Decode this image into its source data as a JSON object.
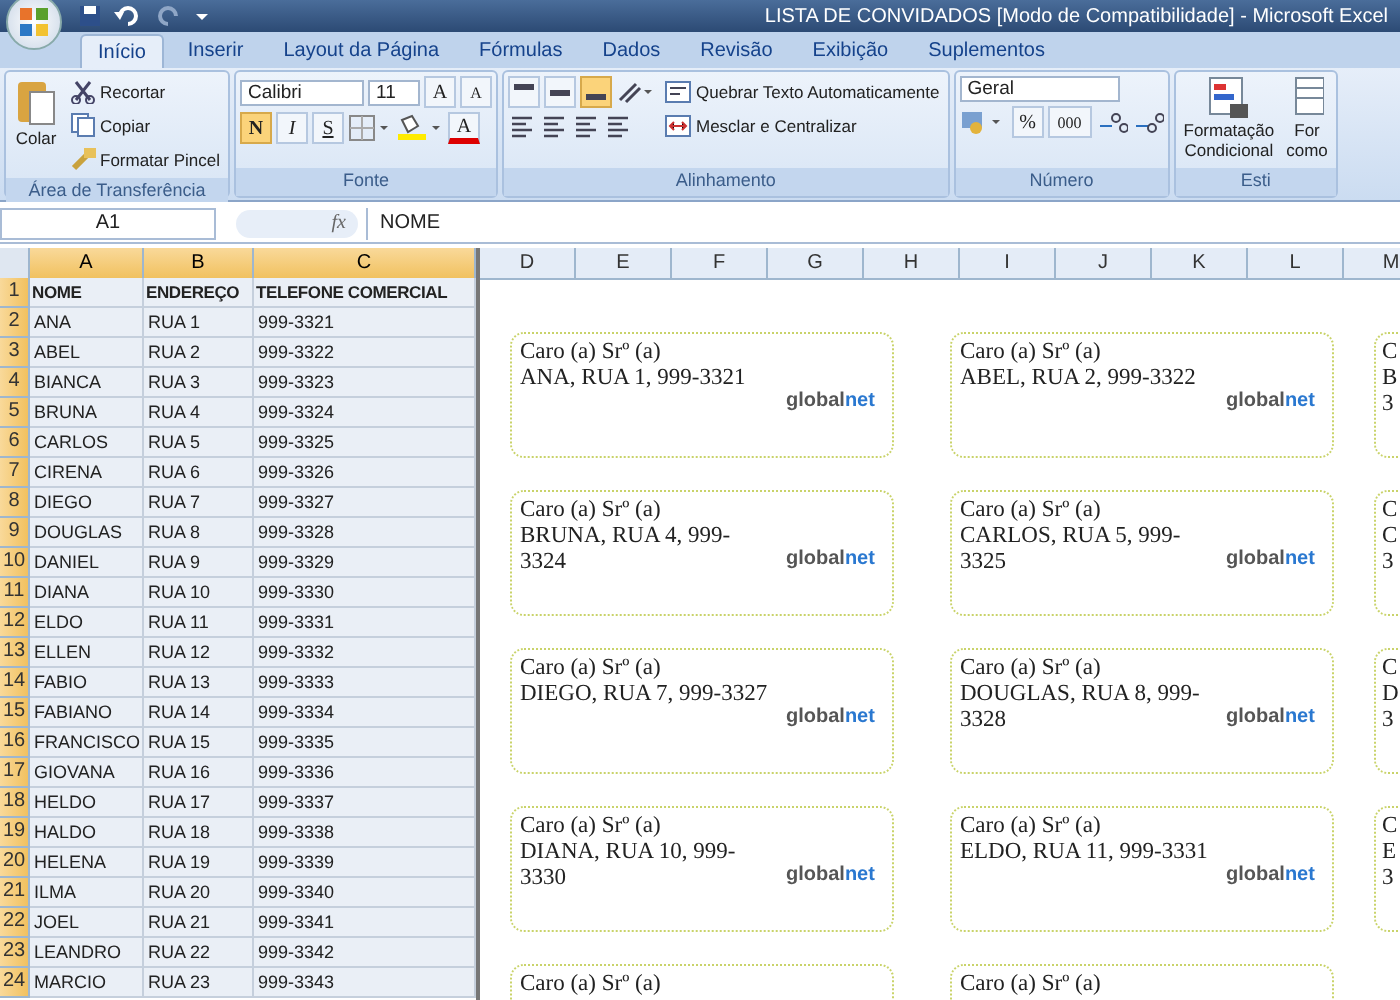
{
  "window": {
    "title": "LISTA DE CONVIDADOS  [Modo de Compatibilidade] - Microsoft Excel"
  },
  "tabs": [
    {
      "label": "Início",
      "selected": true
    },
    {
      "label": "Inserir",
      "selected": false
    },
    {
      "label": "Layout da Página",
      "selected": false
    },
    {
      "label": "Fórmulas",
      "selected": false
    },
    {
      "label": "Dados",
      "selected": false
    },
    {
      "label": "Revisão",
      "selected": false
    },
    {
      "label": "Exibição",
      "selected": false
    },
    {
      "label": "Suplementos",
      "selected": false
    }
  ],
  "ribbon": [
    {
      "kind": "clipboard",
      "label": "Área de Transferência",
      "paste": "Colar",
      "actions": [
        "Recortar",
        "Copiar",
        "Formatar Pincel"
      ]
    },
    {
      "kind": "font",
      "label": "Fonte",
      "font_name": "Calibri",
      "font_size": "11",
      "grow": "A",
      "shrink": "A",
      "font_color": "A",
      "styles": [
        {
          "label": "N",
          "on": true
        },
        {
          "label": "I",
          "on": false
        },
        {
          "label": "S",
          "on": false
        }
      ]
    },
    {
      "kind": "alignment",
      "label": "Alinhamento",
      "vertical": [
        {
          "selected": false
        },
        {
          "selected": false
        },
        {
          "selected": true
        }
      ],
      "wrap_text": "Quebrar Texto Automaticamente",
      "merge": "Mesclar e Centralizar"
    },
    {
      "kind": "number",
      "label": "Número",
      "format": "Geral",
      "percent": "%",
      "thousands": "000"
    },
    {
      "kind": "styles",
      "label": "Esti",
      "conditional": [
        "Formatação",
        "Condicional"
      ],
      "table": [
        "For",
        "como"
      ]
    }
  ],
  "formula_bar": {
    "name_box": "A1",
    "function_label": "fx",
    "content": "NOME"
  },
  "sheet": {
    "columns": [
      {
        "label": "A",
        "selected": true
      },
      {
        "label": "B",
        "selected": true
      },
      {
        "label": "C",
        "selected": true
      },
      {
        "label": "D",
        "selected": false
      },
      {
        "label": "E",
        "selected": false
      },
      {
        "label": "F",
        "selected": false
      },
      {
        "label": "G",
        "selected": false
      },
      {
        "label": "H",
        "selected": false
      },
      {
        "label": "I",
        "selected": false
      },
      {
        "label": "J",
        "selected": false
      },
      {
        "label": "K",
        "selected": false
      },
      {
        "label": "L",
        "selected": false
      },
      {
        "label": "M",
        "selected": false
      }
    ],
    "rows": [
      {
        "number": "1",
        "selected": true,
        "cells": [
          "NOME",
          "ENDEREÇO",
          "TELEFONE COMERCIAL"
        ]
      },
      {
        "number": "2",
        "selected": true,
        "cells": [
          "ANA",
          "RUA 1",
          "999-3321"
        ]
      },
      {
        "number": "3",
        "selected": true,
        "cells": [
          "ABEL",
          "RUA 2",
          "999-3322"
        ]
      },
      {
        "number": "4",
        "selected": true,
        "cells": [
          "BIANCA",
          "RUA 3",
          "999-3323"
        ]
      },
      {
        "number": "5",
        "selected": true,
        "cells": [
          "BRUNA",
          "RUA 4",
          "999-3324"
        ]
      },
      {
        "number": "6",
        "selected": true,
        "cells": [
          "CARLOS",
          "RUA 5",
          "999-3325"
        ]
      },
      {
        "number": "7",
        "selected": true,
        "cells": [
          "CIRENA",
          "RUA 6",
          "999-3326"
        ]
      },
      {
        "number": "8",
        "selected": true,
        "cells": [
          "DIEGO",
          "RUA 7",
          "999-3327"
        ]
      },
      {
        "number": "9",
        "selected": true,
        "cells": [
          "DOUGLAS",
          "RUA 8",
          "999-3328"
        ]
      },
      {
        "number": "10",
        "selected": true,
        "cells": [
          "DANIEL",
          "RUA 9",
          "999-3329"
        ]
      },
      {
        "number": "11",
        "selected": true,
        "cells": [
          "DIANA",
          "RUA 10",
          "999-3330"
        ]
      },
      {
        "number": "12",
        "selected": true,
        "cells": [
          "ELDO",
          "RUA 11",
          "999-3331"
        ]
      },
      {
        "number": "13",
        "selected": true,
        "cells": [
          "ELLEN",
          "RUA 12",
          "999-3332"
        ]
      },
      {
        "number": "14",
        "selected": true,
        "cells": [
          "FABIO",
          "RUA 13",
          "999-3333"
        ]
      },
      {
        "number": "15",
        "selected": true,
        "cells": [
          "FABIANO",
          "RUA 14",
          "999-3334"
        ]
      },
      {
        "number": "16",
        "selected": true,
        "cells": [
          "FRANCISCO",
          "RUA 15",
          "999-3335"
        ]
      },
      {
        "number": "17",
        "selected": true,
        "cells": [
          "GIOVANA",
          "RUA 16",
          "999-3336"
        ]
      },
      {
        "number": "18",
        "selected": true,
        "cells": [
          "HELDO",
          "RUA 17",
          "999-3337"
        ]
      },
      {
        "number": "19",
        "selected": true,
        "cells": [
          "HALDO",
          "RUA 18",
          "999-3338"
        ]
      },
      {
        "number": "20",
        "selected": true,
        "cells": [
          "HELENA",
          "RUA 19",
          "999-3339"
        ]
      },
      {
        "number": "21",
        "selected": true,
        "cells": [
          "ILMA",
          "RUA 20",
          "999-3340"
        ]
      },
      {
        "number": "22",
        "selected": true,
        "cells": [
          "JOEL",
          "RUA 21",
          "999-3341"
        ]
      },
      {
        "number": "23",
        "selected": true,
        "cells": [
          "LEANDRO",
          "RUA 22",
          "999-3342"
        ]
      },
      {
        "number": "24",
        "selected": true,
        "cells": [
          "MARCIO",
          "RUA 23",
          "999-3343"
        ]
      }
    ]
  },
  "labels": [
    {
      "cards": [
        {
          "kind": "full",
          "lines": [
            "Caro (a) Srº (a)",
            "ANA, RUA 1, 999-3321"
          ],
          "logo": [
            "global",
            "net"
          ]
        },
        {
          "kind": "full",
          "lines": [
            "Caro (a) Srº (a)",
            "ABEL, RUA 2, 999-3322"
          ],
          "logo": [
            "global",
            "net"
          ]
        },
        {
          "kind": "partial",
          "lines": [
            "C",
            "B",
            "3"
          ]
        }
      ]
    },
    {
      "cards": [
        {
          "kind": "full",
          "lines": [
            "Caro (a) Srº (a)",
            "BRUNA, RUA 4, 999-3324"
          ],
          "logo": [
            "global",
            "net"
          ]
        },
        {
          "kind": "full",
          "lines": [
            "Caro (a) Srº (a)",
            "CARLOS, RUA 5, 999-3325"
          ],
          "logo": [
            "global",
            "net"
          ]
        },
        {
          "kind": "partial",
          "lines": [
            "C",
            "C",
            "3"
          ]
        }
      ]
    },
    {
      "cards": [
        {
          "kind": "full",
          "lines": [
            "Caro (a) Srº (a)",
            "DIEGO, RUA 7, 999-3327"
          ],
          "logo": [
            "global",
            "net"
          ]
        },
        {
          "kind": "full",
          "lines": [
            "Caro (a) Srº (a)",
            "DOUGLAS, RUA 8, 999-3328"
          ],
          "logo": [
            "global",
            "net"
          ]
        },
        {
          "kind": "partial",
          "lines": [
            "C",
            "D",
            "3"
          ]
        }
      ]
    },
    {
      "cards": [
        {
          "kind": "full",
          "lines": [
            "Caro (a) Srº (a)",
            "DIANA, RUA 10, 999-3330"
          ],
          "logo": [
            "global",
            "net"
          ]
        },
        {
          "kind": "full",
          "lines": [
            "Caro (a) Srº (a)",
            "ELDO, RUA 11, 999-3331"
          ],
          "logo": [
            "global",
            "net"
          ]
        },
        {
          "kind": "partial",
          "lines": [
            "C",
            "E",
            "3"
          ]
        }
      ]
    },
    {
      "cards": [
        {
          "kind": "full",
          "lines": [
            "Caro (a) Srº (a)"
          ]
        },
        {
          "kind": "full",
          "lines": [
            "Caro (a) Srº (a)"
          ]
        }
      ]
    }
  ]
}
